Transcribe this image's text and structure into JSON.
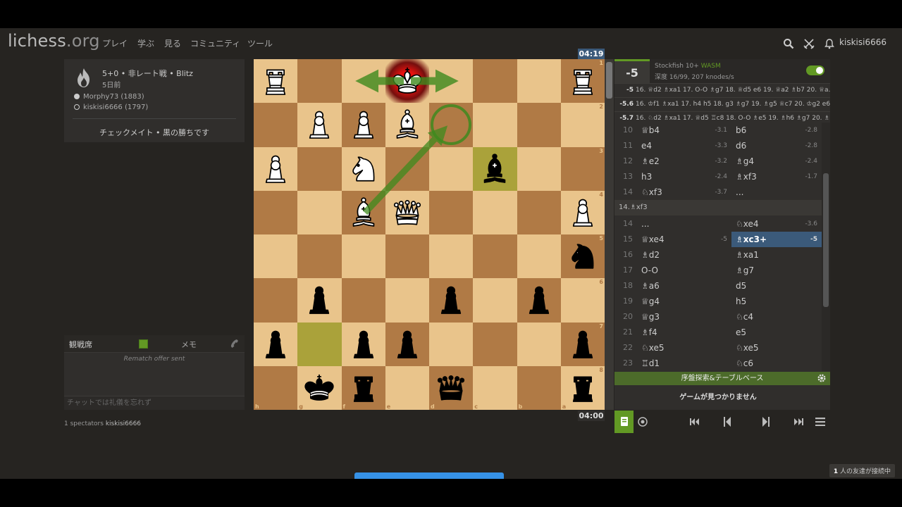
{
  "header": {
    "logo": "lichess",
    "logo_tld": ".org",
    "nav": [
      "プレイ",
      "学ぶ",
      "見る",
      "コミュニティ",
      "ツール"
    ],
    "username": "kiskisi6666"
  },
  "game_info": {
    "title": "5+0 • 非レート戦 • Blitz",
    "date": "5日前",
    "white_player": "Morphy73 (1883)",
    "black_player": "kiskisi6666 (1797)",
    "result": "チェックメイト • 黒の勝ちです"
  },
  "chat": {
    "tab_room": "観戦席",
    "tab_notes": "メモ",
    "message": "Rematch offer sent",
    "input_placeholder": "チャットでは礼儀を忘れず"
  },
  "spectators": {
    "label": "1 spectators",
    "name": "kiskisi6666"
  },
  "clocks": {
    "top": "04:19",
    "bottom": "04:00"
  },
  "board": {
    "orientation": "black",
    "ranks": [
      "1",
      "2",
      "3",
      "4",
      "5",
      "6",
      "7",
      "8"
    ],
    "files": [
      "h",
      "g",
      "f",
      "e",
      "d",
      "c",
      "b",
      "a"
    ],
    "rows": [
      [
        "wR",
        "",
        "",
        "wK",
        "",
        "",
        "",
        "wR"
      ],
      [
        "",
        "wP",
        "wP",
        "wB",
        "",
        "",
        "",
        ""
      ],
      [
        "wP",
        "",
        "wN",
        "",
        "",
        "bB",
        "",
        ""
      ],
      [
        "",
        "",
        "wB",
        "wQ",
        "",
        "",
        "",
        "wP"
      ],
      [
        "",
        "",
        "",
        "",
        "",
        "",
        "",
        "bN"
      ],
      [
        "",
        "bP",
        "",
        "",
        "bP",
        "",
        "bP",
        ""
      ],
      [
        "bP",
        "",
        "bP",
        "bP",
        "",
        "",
        "",
        "bP"
      ],
      [
        "",
        "bK",
        "bR",
        "",
        "bQ",
        "",
        "",
        "bR"
      ]
    ],
    "check_square": "e1",
    "highlight_squares": [
      "c3",
      "g7"
    ],
    "colors": {
      "light": "#e9c48b",
      "dark": "#b07a45",
      "arrow": "#3f8a1e"
    }
  },
  "engine": {
    "score": "-5",
    "name": "Stockfish 10+",
    "tag": "WASM",
    "depth": "深度 16/99, 207 knodes/s",
    "pv": [
      {
        "eval": "-5",
        "line": "16. ♕d2 ♗xa1 17. O-O ♗g7 18. ♕d5 e6 19. ♕a2 ♗b7 20. ♕a..."
      },
      {
        "eval": "-5.6",
        "line": "16. ♔f1 ♗xa1 17. h4 h5 18. g3 ♗g7 19. ♗g5 ♕c7 20. ♔g2 e6 ..."
      },
      {
        "eval": "-5.7",
        "line": "16. ♘d2 ♗xa1 17. ♕d5 ♖c8 18. O-O ♗e5 19. ♗h6 ♗g7 20. ♗..."
      }
    ]
  },
  "moves_top": [
    {
      "n": "10",
      "w": "♕b4",
      "we": "-3.1",
      "b": "b6",
      "be": "-2.8"
    },
    {
      "n": "11",
      "w": "e4",
      "we": "-3.3",
      "b": "d6",
      "be": "-2.8"
    },
    {
      "n": "12",
      "w": "♗e2",
      "we": "-3.2",
      "b": "♗g4",
      "be": "-2.4"
    },
    {
      "n": "13",
      "w": "h3",
      "we": "-2.4",
      "b": "♗xf3",
      "be": "-1.7"
    },
    {
      "n": "14",
      "w": "♘xf3",
      "we": "-3.7",
      "b": "...",
      "be": ""
    }
  ],
  "move_comment": "14.♗xf3",
  "moves_bottom": [
    {
      "n": "14",
      "w": "...",
      "we": "",
      "b": "♘xe4",
      "be": "-3.6"
    },
    {
      "n": "15",
      "w": "♕xe4",
      "we": "-5",
      "b": "♗xc3+",
      "be": "-5",
      "active": true
    },
    {
      "n": "16",
      "w": "♗d2",
      "we": "",
      "b": "♗xa1",
      "be": ""
    },
    {
      "n": "17",
      "w": "O-O",
      "we": "",
      "b": "♗g7",
      "be": ""
    },
    {
      "n": "18",
      "w": "♗a6",
      "we": "",
      "b": "d5",
      "be": ""
    },
    {
      "n": "19",
      "w": "♕g4",
      "we": "",
      "b": "h5",
      "be": ""
    },
    {
      "n": "20",
      "w": "♕g3",
      "we": "",
      "b": "♘c4",
      "be": ""
    },
    {
      "n": "21",
      "w": "♗f4",
      "we": "",
      "b": "e5",
      "be": ""
    },
    {
      "n": "22",
      "w": "♘xe5",
      "we": "",
      "b": "♘xe5",
      "be": ""
    },
    {
      "n": "23",
      "w": "♖d1",
      "we": "",
      "b": "♘c6",
      "be": ""
    }
  ],
  "explorer": {
    "label": "序盤探索&テーブルベース",
    "empty": "ゲームが見つかりません"
  },
  "friends": {
    "count": "1",
    "label": "人の友達が接続中"
  }
}
